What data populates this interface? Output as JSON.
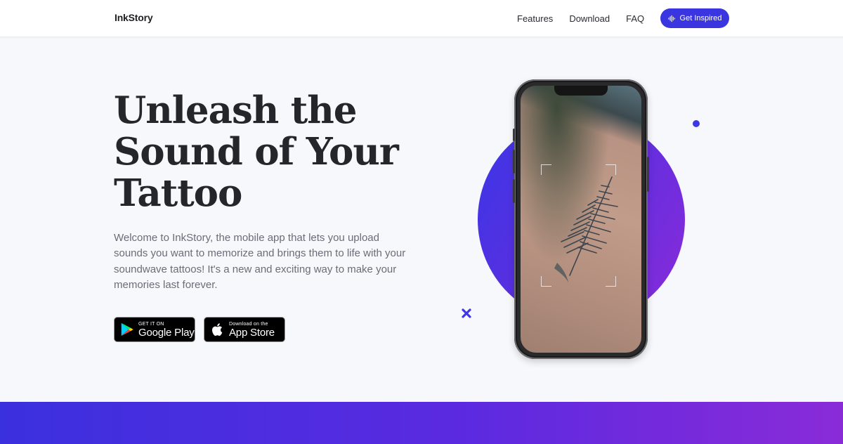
{
  "brand": {
    "name": "InkStory"
  },
  "nav": {
    "links": [
      "Features",
      "Download",
      "FAQ"
    ],
    "cta_label": "Get Inspired"
  },
  "hero": {
    "title": "Unleash the Sound of Your Tattoo",
    "description": "Welcome to InkStory, the mobile app that lets you upload sounds you want to memorize and brings them to life with your soundwave tattoos! It's a new and exciting way to make your memories last forever."
  },
  "stores": {
    "google_play": {
      "small": "GET IT ON",
      "big": "Google Play"
    },
    "app_store": {
      "small": "Download on the",
      "big": "App Store"
    }
  },
  "colors": {
    "accent": "#3a35e0",
    "gradient_start": "#3b36e6",
    "gradient_end": "#8a2bd9",
    "page_bg": "#f7f8fb"
  },
  "icons": {
    "cta": "soundwave-icon",
    "google_play": "google-play-icon",
    "app_store": "apple-icon",
    "decor_x": "x-mark-icon"
  }
}
